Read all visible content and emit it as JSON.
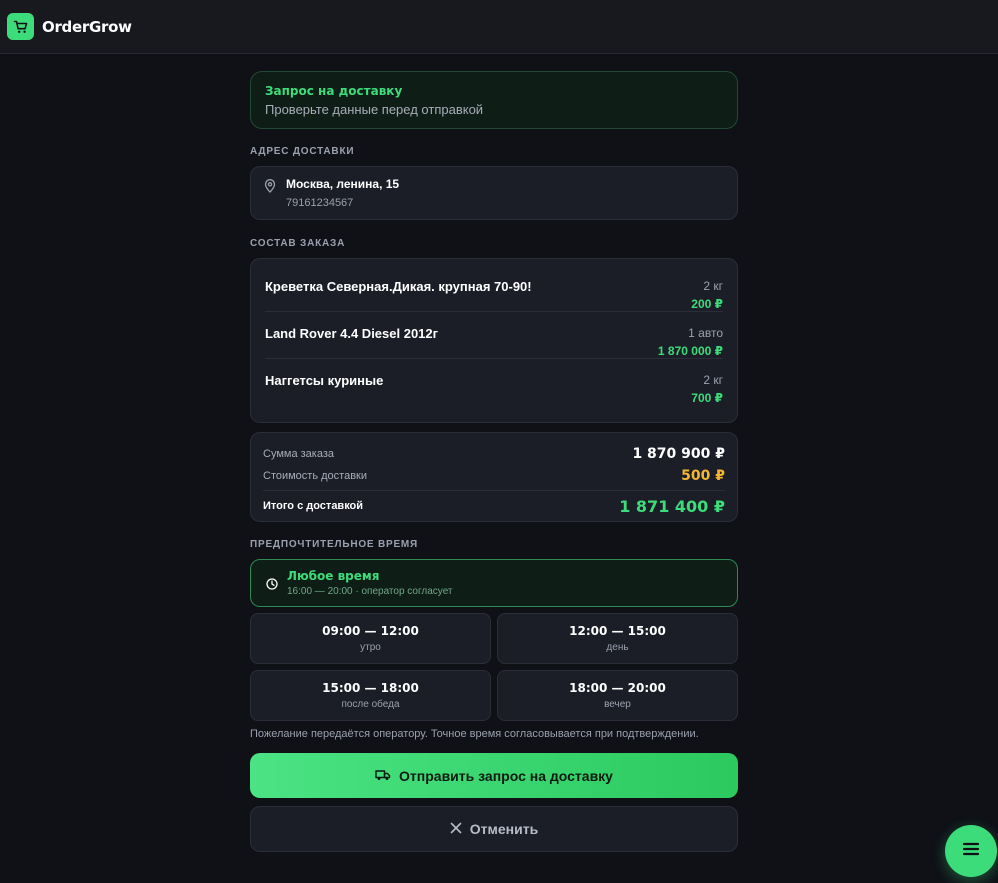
{
  "app": {
    "brand": "OrderGrow",
    "logo_icon": "cart-icon"
  },
  "request": {
    "title": "Запрос на доставку",
    "subtitle": "Проверьте данные перед отправкой"
  },
  "address": {
    "section_label": "АДРЕС ДОСТАВКИ",
    "icon": "map-pin-icon",
    "line": "Москва, ленина, 15",
    "phone": "79161234567"
  },
  "order": {
    "section_label": "СОСТАВ ЗАКАЗА",
    "items": [
      {
        "name": "Креветка Северная.Дикая. крупная 70-90!",
        "qty": "2 кг",
        "price": "200 ₽"
      },
      {
        "name": "Land Rover 4.4 Diesel 2012г",
        "qty": "1 авто",
        "price": "1 870 000 ₽"
      },
      {
        "name": "Наггетсы куриные",
        "qty": "2 кг",
        "price": "700 ₽"
      }
    ]
  },
  "summary": {
    "order_sum_label": "Сумма заказа",
    "order_sum_value": "1 870 900 ₽",
    "delivery_label": "Стоимость доставки",
    "delivery_value": "500 ₽",
    "total_label": "Итого с доставкой",
    "total_value": "1 871 400 ₽"
  },
  "time": {
    "section_label": "ПРЕДПОЧТИТЕЛЬНОЕ ВРЕМЯ",
    "any": {
      "title": "Любое время",
      "subtitle": "16:00 — 20:00 · оператор согласует",
      "icon": "clock-icon"
    },
    "slots": [
      {
        "time": "09:00 — 12:00",
        "label": "утро"
      },
      {
        "time": "12:00 — 15:00",
        "label": "день"
      },
      {
        "time": "15:00 — 18:00",
        "label": "после обеда"
      },
      {
        "time": "18:00 — 20:00",
        "label": "вечер"
      }
    ],
    "note": "Пожелание передаётся оператору. Точное время согласовывается при подтверждении."
  },
  "actions": {
    "send_label": "Отправить запрос на доставку",
    "send_icon": "truck-icon",
    "cancel_label": "Отменить",
    "cancel_icon": "close-icon"
  },
  "fab": {
    "icon": "menu-icon"
  },
  "colors": {
    "accent": "#3ddc7a",
    "delivery_price": "#f5b731",
    "background": "#0f1117",
    "card": "#1b1e27"
  }
}
